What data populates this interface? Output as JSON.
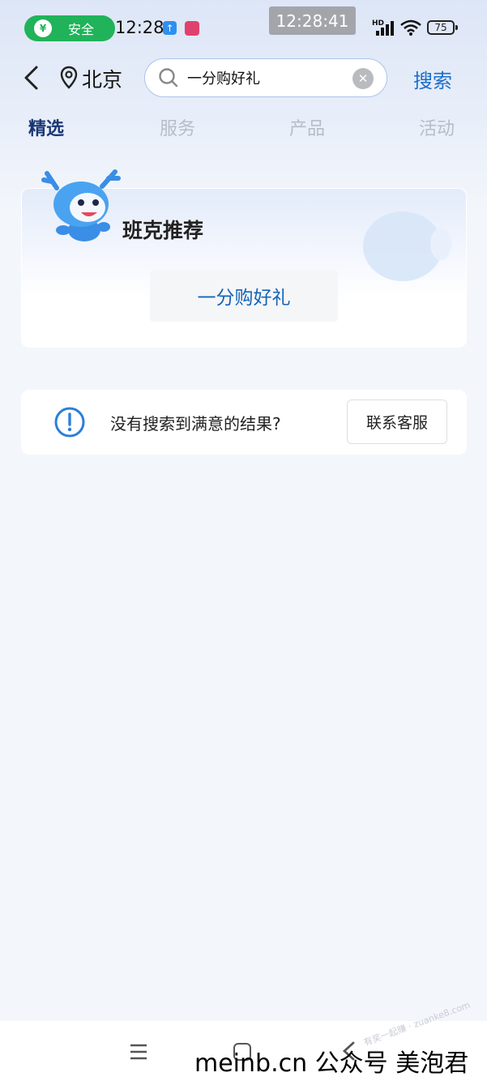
{
  "status_bar": {
    "safe_label": "安全",
    "time": "12:28",
    "clock_overlay": "12:28:41",
    "network": "HD",
    "battery": "75"
  },
  "header": {
    "city": "北京",
    "search_value": "一分购好礼",
    "search_button": "搜索"
  },
  "tabs": [
    {
      "label": "精选",
      "active": true
    },
    {
      "label": "服务",
      "active": false
    },
    {
      "label": "产品",
      "active": false
    },
    {
      "label": "活动",
      "active": false
    }
  ],
  "recommend": {
    "title": "班克推荐",
    "chip": "一分购好礼"
  },
  "help": {
    "text": "没有搜索到满意的结果?",
    "button": "联系客服"
  },
  "watermark": {
    "text": "meinb.cn  公众号 美泡君",
    "faint": "有奖一起赚 · zuanke8.com"
  },
  "colors": {
    "accent": "#1b6ecb",
    "tab_active": "#1a3775",
    "safe_green": "#20b35a"
  }
}
